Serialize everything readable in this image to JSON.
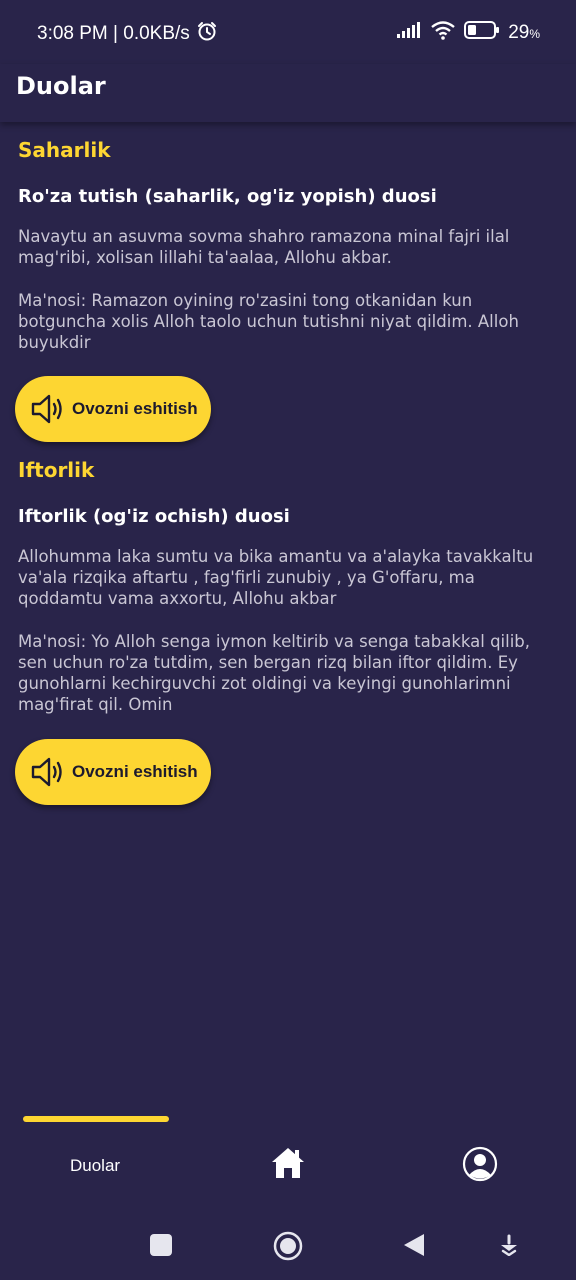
{
  "status": {
    "time_speed": "3:08 PM | 0.0KB/s",
    "battery": "29",
    "battery_unit": "%",
    "icons": [
      "alarm-icon",
      "signal-icon",
      "wifi-icon",
      "battery-icon"
    ]
  },
  "app_bar": {
    "title": "Duolar"
  },
  "sections": [
    {
      "heading": "Saharlik",
      "title": "Ro'za tutish (saharlik, og'iz yopish) duosi",
      "text": "Navaytu an asuvma sovma shahro ramazona minal fajri ilal mag'ribi, xolisan lillahi ta'aalaa, Allohu akbar.",
      "meaning": "Ma'nosi: Ramazon oyining ro'zasini tong otkanidan kun botguncha xolis Alloh taolo uchun tutishni niyat qildim. Alloh buyukdir",
      "button": "Ovozni eshitish"
    },
    {
      "heading": "Iftorlik",
      "title": "Iftorlik (og'iz ochish) duosi",
      "text": "Allohumma laka sumtu va bika amantu va a'alayka tavakkaltu va'ala rizqika aftartu , fag'firli zunubiy , ya G'offaru, ma qoddamtu vama axxortu, Allohu akbar",
      "meaning": "Ma'nosi: Yo Alloh senga iymon keltirib va senga tabakkal qilib, sen uchun ro'za tutdim, sen bergan rizq bilan iftor qildim. Ey gunohlarni kechirguvchi zot oldingi va keyingi gunohlarimni mag'firat qil. Omin",
      "button": "Ovozni eshitish"
    }
  ],
  "bottom_nav": {
    "active_label": "Duolar",
    "items": [
      "duolar-tab",
      "home-icon",
      "profile-icon"
    ]
  },
  "colors": {
    "background": "#29244a",
    "accent": "#fdd632",
    "body_text": "#c9c6d4"
  }
}
